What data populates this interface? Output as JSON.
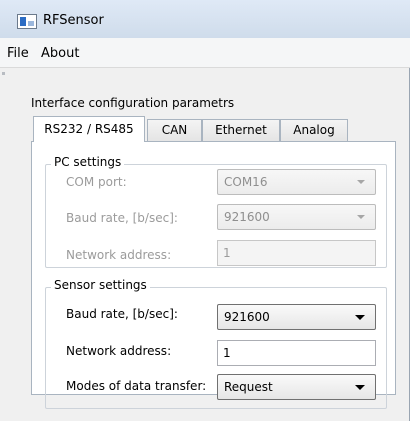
{
  "window": {
    "title": "RFSensor"
  },
  "menu": {
    "file": "File",
    "about": "About"
  },
  "section_title": "Interface configuration parametrs",
  "tabs": [
    {
      "label": "RS232 / RS485",
      "active": true
    },
    {
      "label": "CAN",
      "active": false
    },
    {
      "label": "Ethernet",
      "active": false
    },
    {
      "label": "Analog",
      "active": false
    }
  ],
  "pc_settings": {
    "title": "PC settings",
    "com_port": {
      "label": "COM port:",
      "value": "COM16"
    },
    "baud_rate": {
      "label": "Baud rate, [b/sec]:",
      "value": "921600"
    },
    "network_address": {
      "label": "Network address:",
      "value": "1"
    }
  },
  "sensor_settings": {
    "title": "Sensor settings",
    "baud_rate": {
      "label": "Baud rate, [b/sec]:",
      "value": "921600"
    },
    "network_address": {
      "label": "Network address:",
      "value": "1"
    },
    "data_transfer_mode": {
      "label": "Modes of data transfer:",
      "value": "Request"
    }
  }
}
